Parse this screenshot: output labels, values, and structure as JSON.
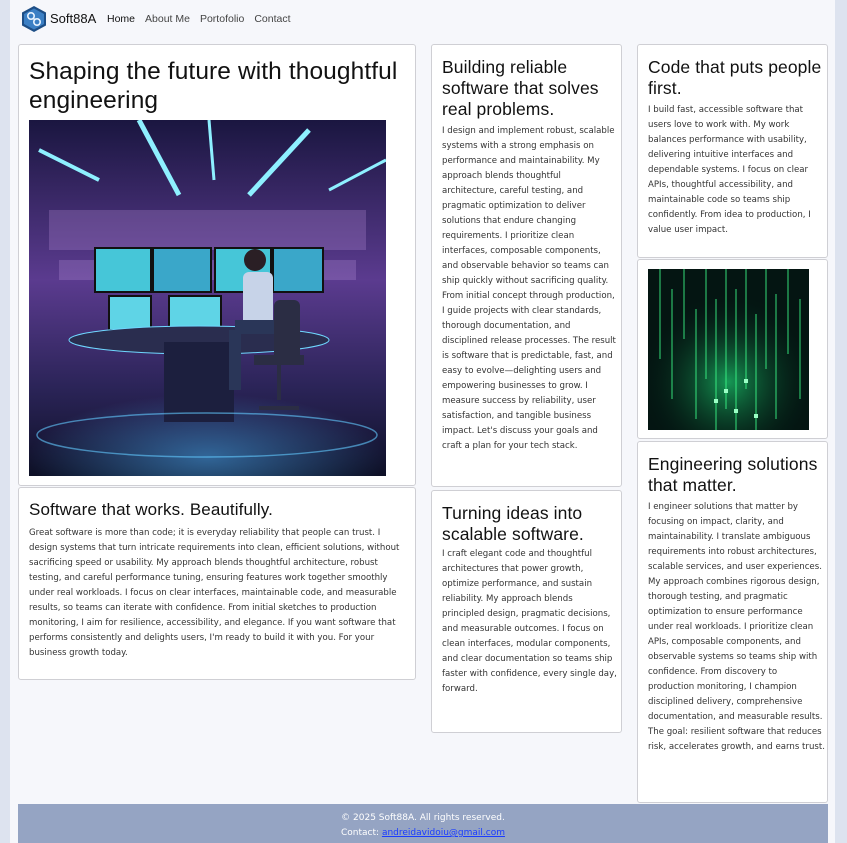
{
  "nav": {
    "brand": "Soft88A",
    "links": [
      "Home",
      "About Me",
      "Portofolio",
      "Contact"
    ]
  },
  "hero": {
    "title": "Shaping the future with thoughtful engineering",
    "image": "developer-at-futuristic-workstation-illustration"
  },
  "works": {
    "title": "Software that works. Beautifully.",
    "body": "Great software is more than code; it is everyday reliability that people can trust. I design systems that turn intricate requirements into clean, efficient solutions, without sacrificing speed or usability. My approach blends thoughtful architecture, robust testing, and careful performance tuning, ensuring features work together smoothly under real workloads. I focus on clear interfaces, maintainable code, and measurable results, so teams can iterate with confidence. From initial sketches to production monitoring, I aim for resilience, accessibility, and elegance. If you want software that performs consistently and delights users, I'm ready to build it with you. For your business growth today."
  },
  "reliable": {
    "title": "Building reliable software that solves real problems.",
    "body": "I design and implement robust, scalable systems with a strong emphasis on performance and maintainability. My approach blends thoughtful architecture, careful testing, and pragmatic optimization to deliver solutions that endure changing requirements. I prioritize clean interfaces, composable components, and observable behavior so teams can ship quickly without sacrificing quality. From initial concept through production, I guide projects with clear standards, thorough documentation, and disciplined release processes. The result is software that is predictable, fast, and easy to evolve—delighting users and empowering businesses to grow. I measure success by reliability, user satisfaction, and tangible business impact. Let's discuss your goals and craft a plan for your tech stack."
  },
  "ideas": {
    "title": "Turning ideas into scalable software.",
    "body": "I craft elegant code and thoughtful architectures that power growth, optimize performance, and sustain reliability. My approach blends principled design, pragmatic decisions, and measurable outcomes. I focus on clean interfaces, modular components, and clear documentation so teams ship faster with confidence, every single day, forward."
  },
  "code": {
    "title": "Code that puts people first.",
    "body": "I build fast, accessible software that users love to work with. My work balances performance with usability, delivering intuitive interfaces and dependable systems. I focus on clear APIs, thoughtful accessibility, and maintainable code so teams ship confidently. From idea to production, I value user impact."
  },
  "matrix": {
    "image": "green-code-rain-illustration"
  },
  "engineering": {
    "title": "Engineering solutions that matter.",
    "body": "I engineer solutions that matter by focusing on impact, clarity, and maintainability. I translate ambiguous requirements into robust architectures, scalable services, and user experiences. My approach combines rigorous design, thorough testing, and pragmatic optimization to ensure performance under real workloads. I prioritize clean APIs, composable components, and observable systems so teams ship with confidence. From discovery to production monitoring, I champion disciplined delivery, comprehensive documentation, and measurable results. The goal: resilient software that reduces risk, accelerates growth, and earns trust."
  },
  "footer": {
    "copyright": "© 2025 Soft88A. All rights reserved.",
    "contact_label": "Contact:",
    "email": "andreidavidoiu@gmail.com"
  },
  "colors": {
    "background": "#dde3ef",
    "footer": "#95a4c3",
    "link": "#1a3cff"
  }
}
